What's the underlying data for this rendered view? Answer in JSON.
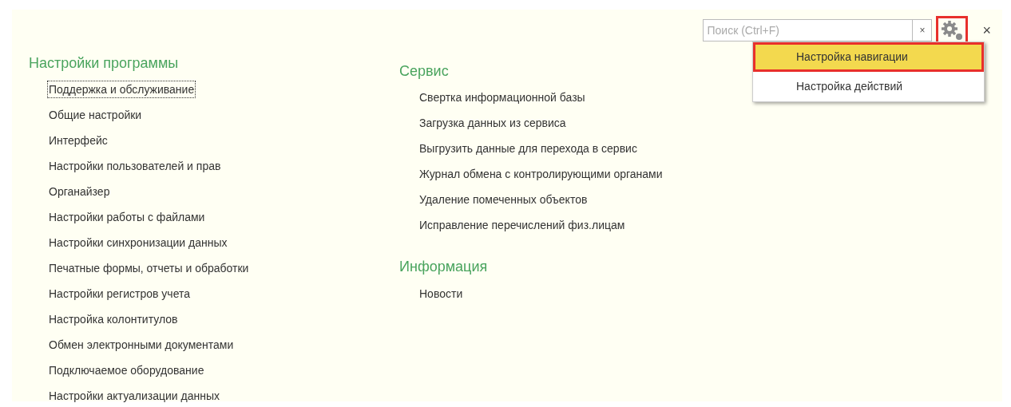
{
  "toolbar": {
    "search": {
      "placeholder": "Поиск (Ctrl+F)"
    },
    "clear_button": "×",
    "settings_button": {
      "highlighted": true
    },
    "close_button": "×"
  },
  "menu": [
    {
      "label": "Настройка навигации",
      "selected": true,
      "highlighted": true
    },
    {
      "label": "Настройка действий",
      "selected": false,
      "highlighted": false
    }
  ],
  "columns": [
    {
      "sections": [
        {
          "title": "Настройки программы",
          "items": [
            {
              "label": "Поддержка и обслуживание",
              "focused": true
            },
            {
              "label": "Общие настройки",
              "focused": false
            },
            {
              "label": "Интерфейс",
              "focused": false
            },
            {
              "label": "Настройки пользователей и прав",
              "focused": false
            },
            {
              "label": "Органайзер",
              "focused": false
            },
            {
              "label": "Настройки работы с файлами",
              "focused": false
            },
            {
              "label": "Настройки синхронизации данных",
              "focused": false
            },
            {
              "label": "Печатные формы, отчеты и обработки",
              "focused": false
            },
            {
              "label": "Настройки регистров учета",
              "focused": false
            },
            {
              "label": "Настройка колонтитулов",
              "focused": false
            },
            {
              "label": "Обмен электронными документами",
              "focused": false
            },
            {
              "label": "Подключаемое оборудование",
              "focused": false
            },
            {
              "label": "Настройки актуализации данных",
              "focused": false
            }
          ]
        }
      ]
    },
    {
      "sections": [
        {
          "title": "Сервис",
          "items": [
            {
              "label": "Свертка информационной базы",
              "focused": false
            },
            {
              "label": "Загрузка данных из сервиса",
              "focused": false
            },
            {
              "label": "Выгрузить данные для перехода в сервис",
              "focused": false
            },
            {
              "label": "Журнал обмена с контролирующими органами",
              "focused": false
            },
            {
              "label": "Удаление помеченных объектов",
              "focused": false
            },
            {
              "label": "Исправление перечислений физ.лицам",
              "focused": false
            }
          ]
        },
        {
          "title": "Информация",
          "items": [
            {
              "label": "Новости",
              "focused": false
            }
          ]
        }
      ]
    }
  ]
}
